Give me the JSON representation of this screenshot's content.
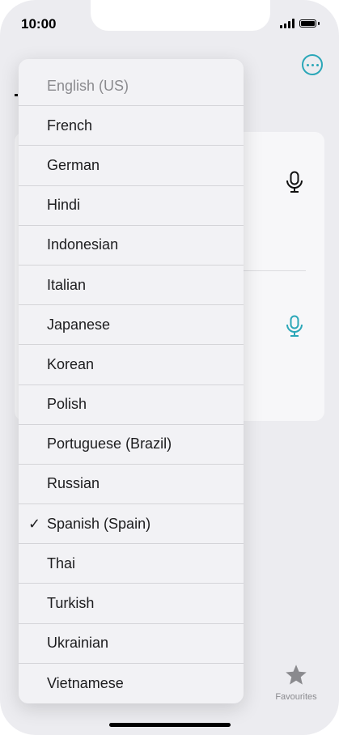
{
  "status_bar": {
    "time": "10:00"
  },
  "language_menu": {
    "items": [
      {
        "label": "English (US)",
        "selected": false,
        "disabled": true
      },
      {
        "label": "French",
        "selected": false,
        "disabled": false
      },
      {
        "label": "German",
        "selected": false,
        "disabled": false
      },
      {
        "label": "Hindi",
        "selected": false,
        "disabled": false
      },
      {
        "label": "Indonesian",
        "selected": false,
        "disabled": false
      },
      {
        "label": "Italian",
        "selected": false,
        "disabled": false
      },
      {
        "label": "Japanese",
        "selected": false,
        "disabled": false
      },
      {
        "label": "Korean",
        "selected": false,
        "disabled": false
      },
      {
        "label": "Polish",
        "selected": false,
        "disabled": false
      },
      {
        "label": "Portuguese (Brazil)",
        "selected": false,
        "disabled": false
      },
      {
        "label": "Russian",
        "selected": false,
        "disabled": false
      },
      {
        "label": "Spanish (Spain)",
        "selected": true,
        "disabled": false
      },
      {
        "label": "Thai",
        "selected": false,
        "disabled": false
      },
      {
        "label": "Turkish",
        "selected": false,
        "disabled": false
      },
      {
        "label": "Ukrainian",
        "selected": false,
        "disabled": false
      },
      {
        "label": "Vietnamese",
        "selected": false,
        "disabled": false
      }
    ],
    "check_glyph": "✓"
  },
  "tab_bar": {
    "favourites_label": "Favourites"
  },
  "colors": {
    "accent": "#2ba7b8",
    "menu_bg": "#f2f2f5",
    "page_bg": "#ececf0"
  },
  "icons": {
    "more": "ellipsis-circle-icon",
    "mic": "microphone-icon",
    "favourites": "star-icon"
  }
}
